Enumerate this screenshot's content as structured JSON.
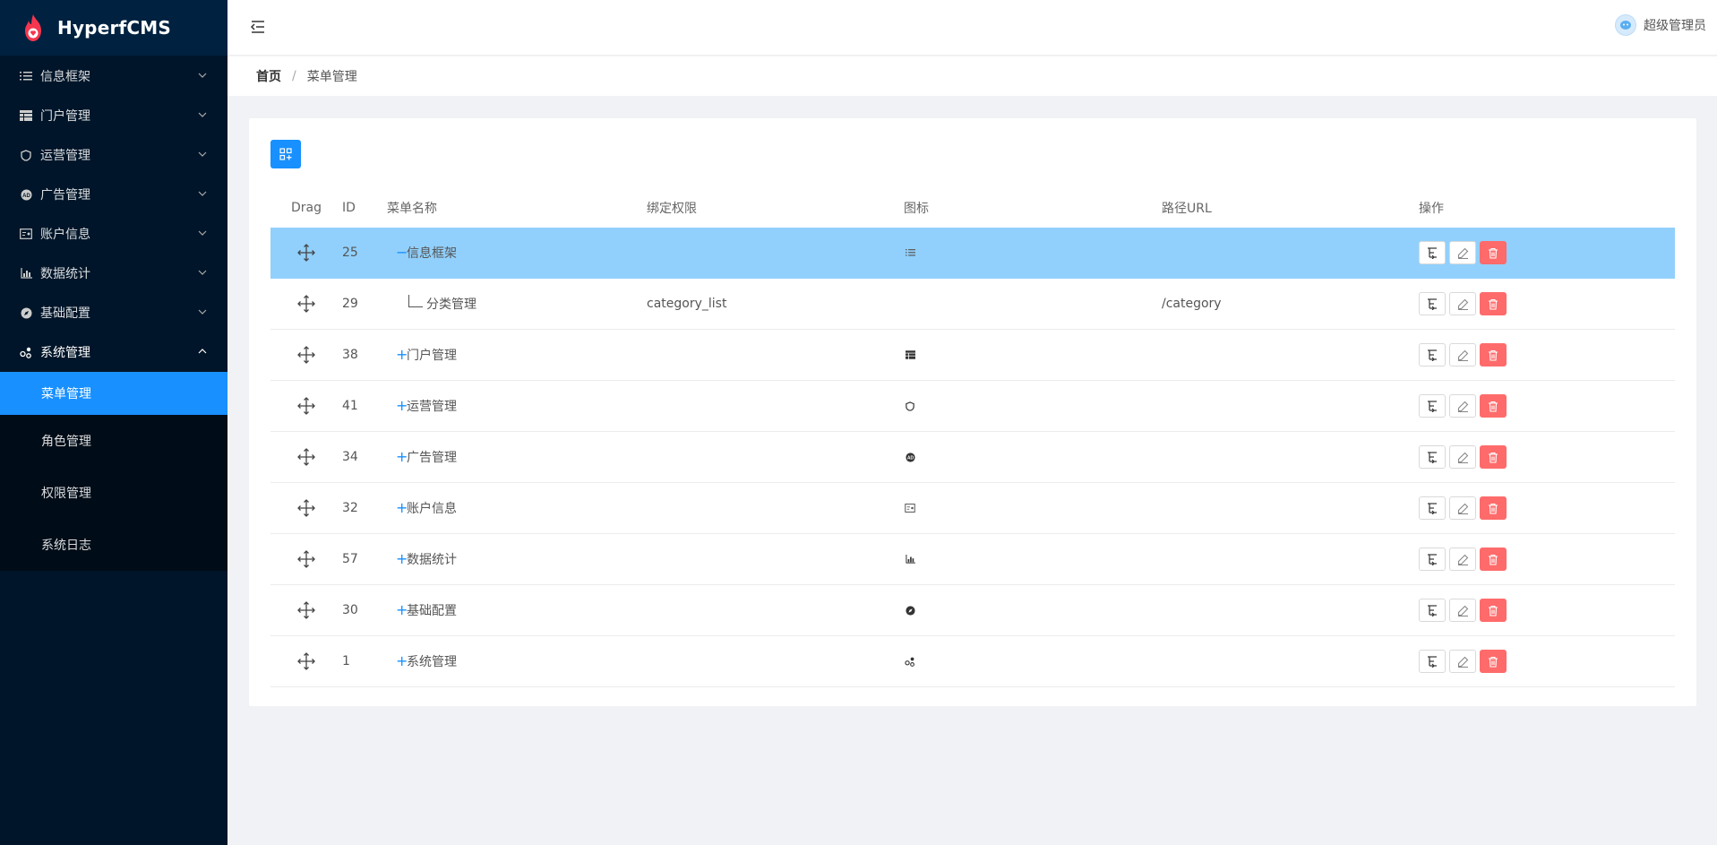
{
  "app": {
    "title": "HyperfCMS"
  },
  "sidebar": {
    "items": [
      {
        "label": "信息框架",
        "icon": "list-icon"
      },
      {
        "label": "门户管理",
        "icon": "table-icon"
      },
      {
        "label": "运营管理",
        "icon": "shield-icon"
      },
      {
        "label": "广告管理",
        "icon": "ad-icon"
      },
      {
        "label": "账户信息",
        "icon": "idcard-icon"
      },
      {
        "label": "数据统计",
        "icon": "chart-icon"
      },
      {
        "label": "基础配置",
        "icon": "compass-icon"
      },
      {
        "label": "系统管理",
        "icon": "cluster-icon"
      }
    ],
    "submenu": [
      {
        "label": "菜单管理",
        "active": true
      },
      {
        "label": "角色管理",
        "active": false
      },
      {
        "label": "权限管理",
        "active": false
      },
      {
        "label": "系统日志",
        "active": false
      }
    ]
  },
  "header": {
    "user": "超级管理员"
  },
  "breadcrumb": {
    "home": "首页",
    "separator": "/",
    "current": "菜单管理"
  },
  "table": {
    "columns": {
      "drag": "Drag",
      "id": "ID",
      "name": "菜单名称",
      "permission": "绑定权限",
      "icon": "图标",
      "url": "路径URL",
      "ops": "操作"
    },
    "rows": [
      {
        "id": "25",
        "expander": "−",
        "name": "信息框架",
        "permission": "",
        "icon": "list-icon",
        "url": "",
        "selected": true
      },
      {
        "id": "29",
        "expander": "",
        "name": "分类管理",
        "permission": "category_list",
        "icon": "",
        "url": "/category",
        "child": true
      },
      {
        "id": "38",
        "expander": "+",
        "name": "门户管理",
        "permission": "",
        "icon": "table-icon",
        "url": ""
      },
      {
        "id": "41",
        "expander": "+",
        "name": "运营管理",
        "permission": "",
        "icon": "shield-icon",
        "url": ""
      },
      {
        "id": "34",
        "expander": "+",
        "name": "广告管理",
        "permission": "",
        "icon": "ad-icon",
        "url": ""
      },
      {
        "id": "32",
        "expander": "+",
        "name": "账户信息",
        "permission": "",
        "icon": "idcard-icon",
        "url": ""
      },
      {
        "id": "57",
        "expander": "+",
        "name": "数据统计",
        "permission": "",
        "icon": "chart-icon",
        "url": ""
      },
      {
        "id": "30",
        "expander": "+",
        "name": "基础配置",
        "permission": "",
        "icon": "compass-icon",
        "url": ""
      },
      {
        "id": "1",
        "expander": "+",
        "name": "系统管理",
        "permission": "",
        "icon": "cluster-icon",
        "url": ""
      }
    ]
  },
  "colors": {
    "sidebar": "#001529",
    "accent": "#1890ff",
    "selected_row": "#91d0fc",
    "danger": "#ff6b6b"
  }
}
